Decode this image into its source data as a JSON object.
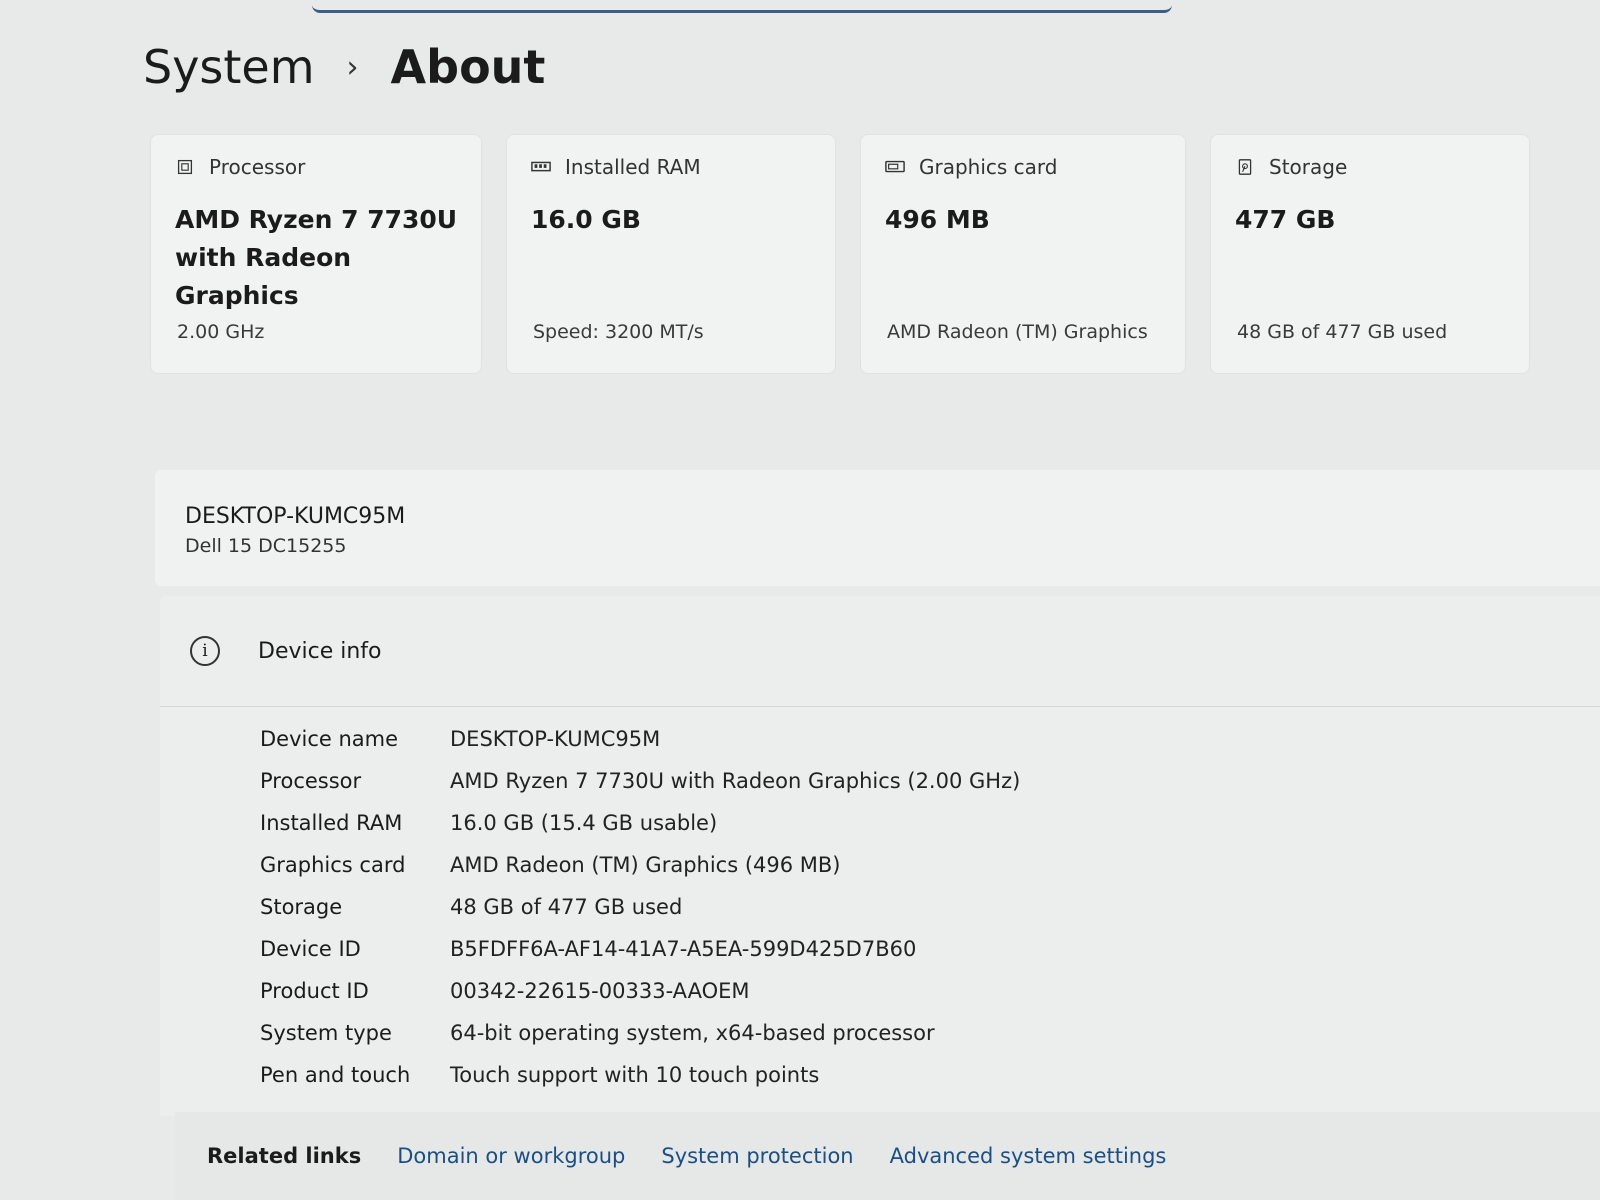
{
  "breadcrumb": {
    "parent": "System",
    "separator": "›",
    "current": "About"
  },
  "cards": [
    {
      "icon": "processor-icon",
      "title": "Processor",
      "value": "AMD Ryzen 7 7730U with Radeon Graphics",
      "sub": "2.00 GHz"
    },
    {
      "icon": "ram-icon",
      "title": "Installed RAM",
      "value": "16.0 GB",
      "sub": "Speed: 3200 MT/s"
    },
    {
      "icon": "graphics-card-icon",
      "title": "Graphics card",
      "value": "496 MB",
      "sub": "AMD Radeon (TM) Graphics"
    },
    {
      "icon": "storage-icon",
      "title": "Storage",
      "value": "477 GB",
      "sub": "48 GB of 477 GB used"
    }
  ],
  "device": {
    "name": "DESKTOP-KUMC95M",
    "model": "Dell 15 DC15255"
  },
  "device_info": {
    "title": "Device info",
    "icon": "info-icon",
    "rows": [
      {
        "label": "Device name",
        "value": "DESKTOP-KUMC95M"
      },
      {
        "label": "Processor",
        "value": "AMD Ryzen 7 7730U with Radeon Graphics (2.00 GHz)"
      },
      {
        "label": "Installed RAM",
        "value": "16.0 GB (15.4 GB usable)"
      },
      {
        "label": "Graphics card",
        "value": "AMD Radeon (TM) Graphics (496 MB)"
      },
      {
        "label": "Storage",
        "value": "48 GB of 477 GB used"
      },
      {
        "label": "Device ID",
        "value": "B5FDFF6A-AF14-41A7-A5EA-599D425D7B60"
      },
      {
        "label": "Product ID",
        "value": "00342-22615-00333-AAOEM"
      },
      {
        "label": "System type",
        "value": "64-bit operating system, x64-based processor"
      },
      {
        "label": "Pen and touch",
        "value": "Touch support with 10 touch points"
      }
    ]
  },
  "related_links": {
    "label": "Related links",
    "links": [
      "Domain or workgroup",
      "System protection",
      "Advanced system settings"
    ]
  },
  "colors": {
    "link": "#1a4f86",
    "card_bg": "#f1f2f2",
    "page_bg": "#e8eaea"
  }
}
